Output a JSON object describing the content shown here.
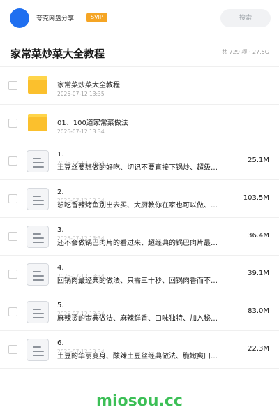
{
  "header": {
    "app_name": "夸克网盘分享",
    "badge": "SVIP",
    "search_placeholder": "搜索"
  },
  "title_bar": {
    "title": "家常菜炒菜大全教程",
    "stats": "共 729 项 · 27.5G"
  },
  "folders": [
    {
      "name": "家常菜炒菜大全教程",
      "date": "2026-07-12 13:35"
    },
    {
      "name": "01、100道家常菜做法",
      "date": "2026-07-12 13:34"
    }
  ],
  "files": [
    {
      "num": "1.",
      "date": "2026-07-12 13:34",
      "desc": "土豆丝要想做的好吃、切记不要直接下锅炒、超级…",
      "size": "25.1M"
    },
    {
      "num": "2.",
      "date": "2026-07-12 13:34",
      "desc": "想吃香辣烤鱼别出去买、大厨教你在家也可以做、…",
      "size": "103.5M"
    },
    {
      "num": "3.",
      "date": "2026-07-12 13:34",
      "desc": "还不会做锅巴肉片的看过来、超经典的锅巴肉片最…",
      "size": "36.4M"
    },
    {
      "num": "4.",
      "date": "2026-07-12 13:34",
      "desc": "回锅肉最经典的做法、只需三十秒、回锅肉香而不…",
      "size": "39.1M"
    },
    {
      "num": "5.",
      "date": "2026-07-12 13:34",
      "desc": "麻辣烫的金典做法、麻辣鲜香、口味独特、加入秘…",
      "size": "83.0M"
    },
    {
      "num": "6.",
      "date": "2026-07-12 13:34",
      "desc": "土豆的华丽变身、酸辣土豆丝经典做法、脆嫩爽口…",
      "size": "22.3M"
    }
  ],
  "watermark": "miosou.cc",
  "colors": {
    "avatar": "#1f6ff0",
    "svip": "#f5a524",
    "folder": "#fbc02d",
    "watermark": "#3cbf56"
  }
}
